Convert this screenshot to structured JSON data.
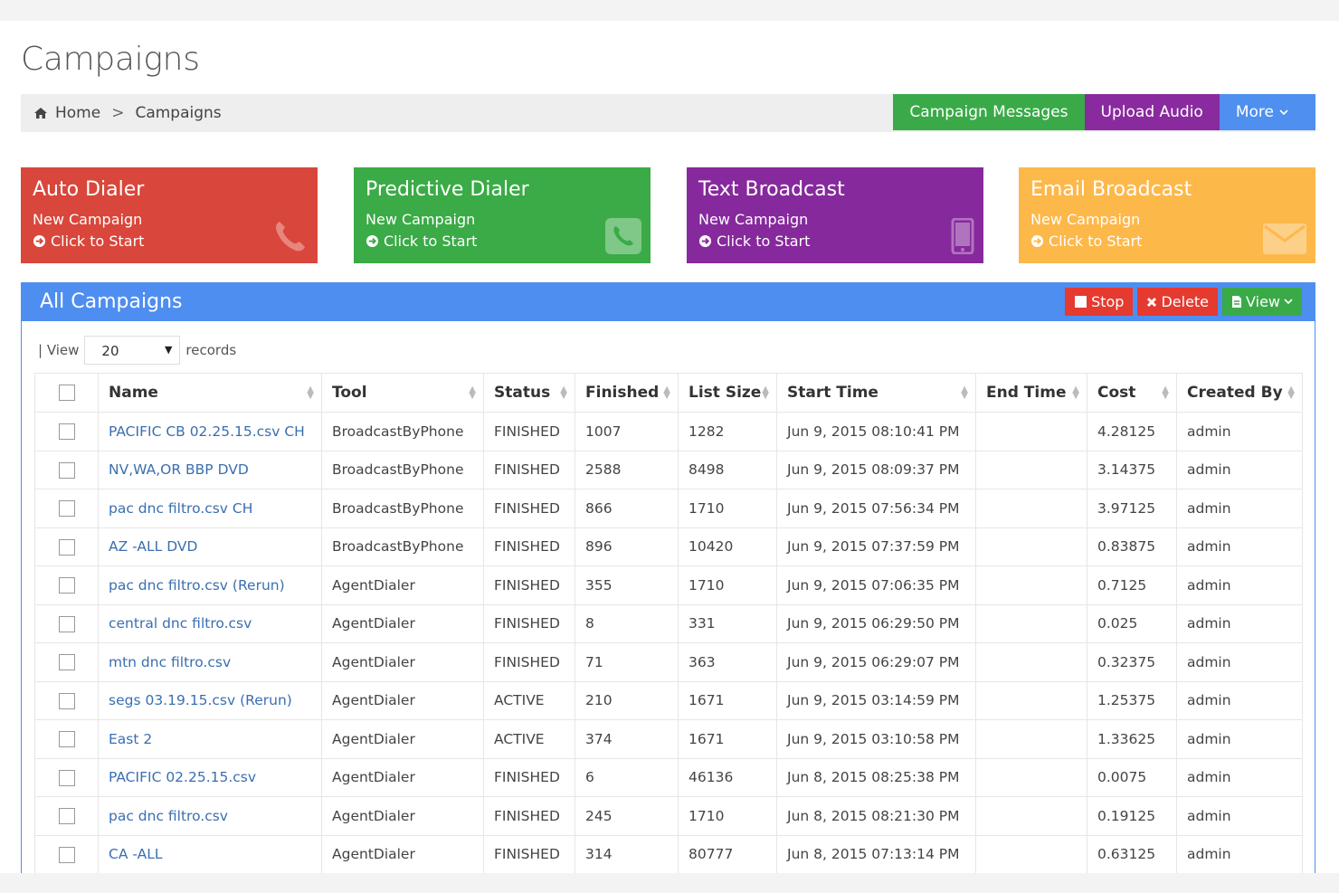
{
  "page": {
    "title": "Campaigns"
  },
  "breadcrumb": {
    "home": "Home",
    "separator": ">",
    "current": "Campaigns"
  },
  "header_buttons": {
    "campaign_messages": "Campaign Messages",
    "upload_audio": "Upload Audio",
    "more": "More"
  },
  "tiles": [
    {
      "title": "Auto Dialer",
      "subtitle": "New Campaign",
      "link": "Click to Start",
      "color": "#d9463b",
      "icon": "phone-icon"
    },
    {
      "title": "Predictive Dialer",
      "subtitle": "New Campaign",
      "link": "Click to Start",
      "color": "#3aab46",
      "icon": "phone-square-icon"
    },
    {
      "title": "Text Broadcast",
      "subtitle": "New Campaign",
      "link": "Click to Start",
      "color": "#86299c",
      "icon": "mobile-icon"
    },
    {
      "title": "Email Broadcast",
      "subtitle": "New Campaign",
      "link": "Click to Start",
      "color": "#fdb84a",
      "icon": "envelope-icon"
    }
  ],
  "panel": {
    "title": "All Campaigns",
    "buttons": {
      "stop": "Stop",
      "delete": "Delete",
      "view": "View"
    },
    "view_label": "| View",
    "view_value": "20",
    "records_label": "records"
  },
  "table": {
    "columns": [
      "Name",
      "Tool",
      "Status",
      "Finished",
      "List Size",
      "Start Time",
      "End Time",
      "Cost",
      "Created By"
    ],
    "rows": [
      [
        "PACIFIC CB 02.25.15.csv CH",
        "BroadcastByPhone",
        "FINISHED",
        "1007",
        "1282",
        "Jun 9, 2015 08:10:41 PM",
        "",
        "4.28125",
        "admin"
      ],
      [
        "NV,WA,OR BBP DVD",
        "BroadcastByPhone",
        "FINISHED",
        "2588",
        "8498",
        "Jun 9, 2015 08:09:37 PM",
        "",
        "3.14375",
        "admin"
      ],
      [
        "pac dnc filtro.csv CH",
        "BroadcastByPhone",
        "FINISHED",
        "866",
        "1710",
        "Jun 9, 2015 07:56:34 PM",
        "",
        "3.97125",
        "admin"
      ],
      [
        "AZ -ALL DVD",
        "BroadcastByPhone",
        "FINISHED",
        "896",
        "10420",
        "Jun 9, 2015 07:37:59 PM",
        "",
        "0.83875",
        "admin"
      ],
      [
        "pac dnc filtro.csv (Rerun)",
        "AgentDialer",
        "FINISHED",
        "355",
        "1710",
        "Jun 9, 2015 07:06:35 PM",
        "",
        "0.7125",
        "admin"
      ],
      [
        "central dnc filtro.csv",
        "AgentDialer",
        "FINISHED",
        "8",
        "331",
        "Jun 9, 2015 06:29:50 PM",
        "",
        "0.025",
        "admin"
      ],
      [
        "mtn dnc filtro.csv",
        "AgentDialer",
        "FINISHED",
        "71",
        "363",
        "Jun 9, 2015 06:29:07 PM",
        "",
        "0.32375",
        "admin"
      ],
      [
        "segs 03.19.15.csv (Rerun)",
        "AgentDialer",
        "ACTIVE",
        "210",
        "1671",
        "Jun 9, 2015 03:14:59 PM",
        "",
        "1.25375",
        "admin"
      ],
      [
        "East 2",
        "AgentDialer",
        "ACTIVE",
        "374",
        "1671",
        "Jun 9, 2015 03:10:58 PM",
        "",
        "1.33625",
        "admin"
      ],
      [
        "PACIFIC 02.25.15.csv",
        "AgentDialer",
        "FINISHED",
        "6",
        "46136",
        "Jun 8, 2015 08:25:38 PM",
        "",
        "0.0075",
        "admin"
      ],
      [
        "pac dnc filtro.csv",
        "AgentDialer",
        "FINISHED",
        "245",
        "1710",
        "Jun 8, 2015 08:21:30 PM",
        "",
        "0.19125",
        "admin"
      ],
      [
        "CA -ALL",
        "AgentDialer",
        "FINISHED",
        "314",
        "80777",
        "Jun 8, 2015 07:13:14 PM",
        "",
        "0.63125",
        "admin"
      ]
    ]
  }
}
